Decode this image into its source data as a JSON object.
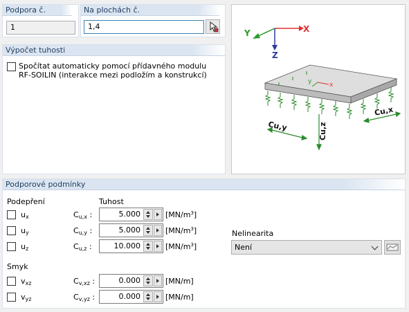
{
  "support_no": {
    "label": "Podpora č.",
    "value": "1"
  },
  "on_surfaces": {
    "label": "Na plochách č.",
    "value": "1,4"
  },
  "stiffness_calc": {
    "title": "Výpočet tuhosti",
    "checkbox_line1": "Spočítat automaticky pomocí přídavného modulu",
    "checkbox_line2": "RF-SOILIN (interakce mezi podložím a konstrukcí)",
    "checked": false
  },
  "diagram": {
    "axis_x": "X",
    "axis_y": "Y",
    "axis_z": "Z",
    "local_x": "x",
    "local_y": "y",
    "label_cux": "Cu,x",
    "label_cuy": "Cu,y",
    "label_cuz": "Cu,z",
    "colors": {
      "axis_x": "#e03030",
      "axis_y": "#2a9a2a",
      "axis_z": "#2a3a9a",
      "slab_top": "#d9d9d9",
      "slab_side": "#bdbdbd",
      "spring": "#2a8a2a"
    }
  },
  "support_conditions": {
    "title": "Podporové podmínky",
    "support_heading": "Podepření",
    "stiffness_heading": "Tuhost",
    "shear_heading": "Smyk",
    "rows": [
      {
        "cb": "u",
        "cb_sub": "x",
        "sym": "C",
        "sym_sub": "u,x",
        "value": "5.000",
        "unit": "[MN/m",
        "unit_sup": "3",
        "unit_end": "]"
      },
      {
        "cb": "u",
        "cb_sub": "y",
        "sym": "C",
        "sym_sub": "u,y",
        "value": "5.000",
        "unit": "[MN/m",
        "unit_sup": "3",
        "unit_end": "]"
      },
      {
        "cb": "u",
        "cb_sub": "z",
        "sym": "C",
        "sym_sub": "u,z",
        "value": "10.000",
        "unit": "[MN/m",
        "unit_sup": "3",
        "unit_end": "]"
      }
    ],
    "shear_rows": [
      {
        "cb": "v",
        "cb_sub": "xz",
        "sym": "C",
        "sym_sub": "v,xz",
        "value": "0.000",
        "unit": "[MN/m]"
      },
      {
        "cb": "v",
        "cb_sub": "yz",
        "sym": "C",
        "sym_sub": "v,yz",
        "value": "0.000",
        "unit": "[MN/m]"
      }
    ],
    "nonlinearity": {
      "label": "Nelinearita",
      "value": "Není"
    }
  }
}
